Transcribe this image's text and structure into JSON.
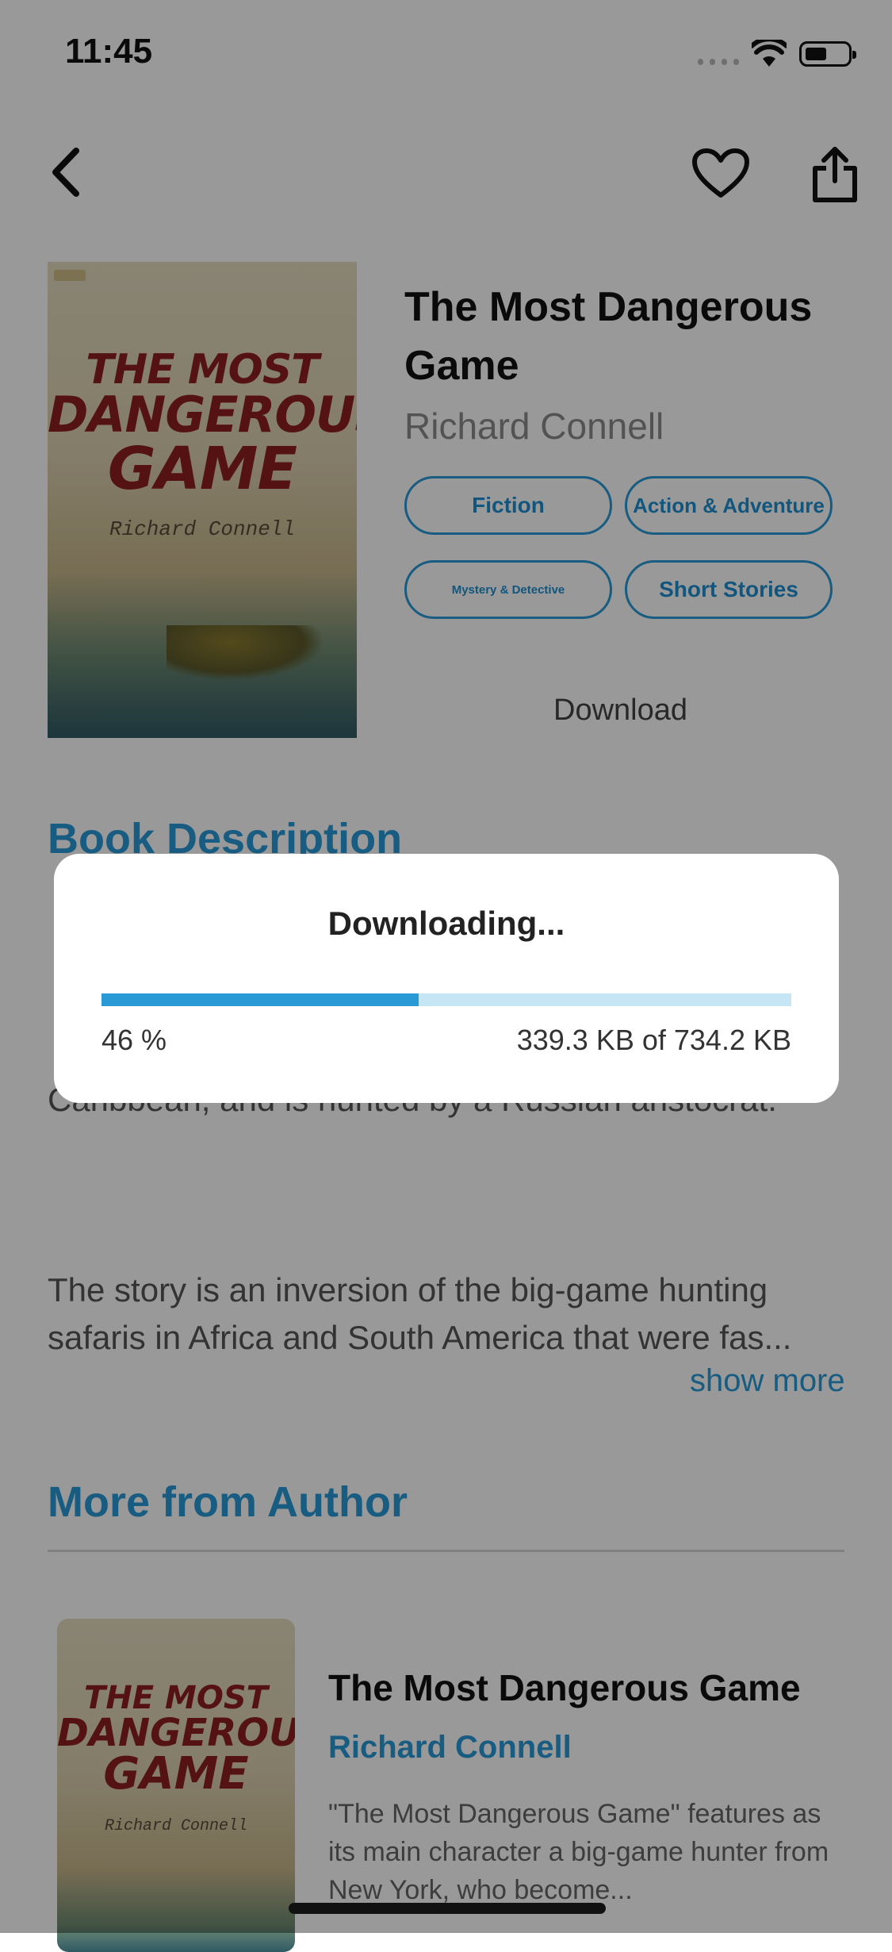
{
  "status_bar": {
    "time": "11:45"
  },
  "book": {
    "title": "The Most Dangerous Game",
    "author": "Richard Connell",
    "cover": {
      "line1": "THE MOST",
      "line2": "DANGEROUS",
      "line3": "GAME",
      "author": "Richard Connell"
    },
    "genres": [
      "Fiction",
      "Action & Adventure",
      "Mystery & Detective",
      "Short Stories"
    ],
    "download_label": "Download"
  },
  "description": {
    "heading": "Book Description",
    "partial_text": "Caribbean, and is hunted by a Russian aristocrat.",
    "paragraph2_line1": "The story is an inversion of the big-game hunting",
    "paragraph2_line2": "safaris in Africa and South America that were fas...",
    "show_more": "show more"
  },
  "more_from_author": {
    "heading": "More from Author",
    "items": [
      {
        "title": "The Most Dangerous Game",
        "author": "Richard Connell",
        "description": "\"The Most Dangerous Game\" features as its main character a big-game hunter from New York, who become..."
      }
    ]
  },
  "download_dialog": {
    "title": "Downloading...",
    "progress_fraction": 0.46,
    "percent_text": "46 %",
    "size_text": "339.3 KB of 734.2 KB"
  },
  "colors": {
    "accent": "#2a9ad7",
    "progress_track": "#c6e6f6",
    "cover_title": "#8d1f1f"
  },
  "icons": {
    "back": "chevron-left-icon",
    "favorite": "heart-outline-icon",
    "share": "share-icon"
  }
}
